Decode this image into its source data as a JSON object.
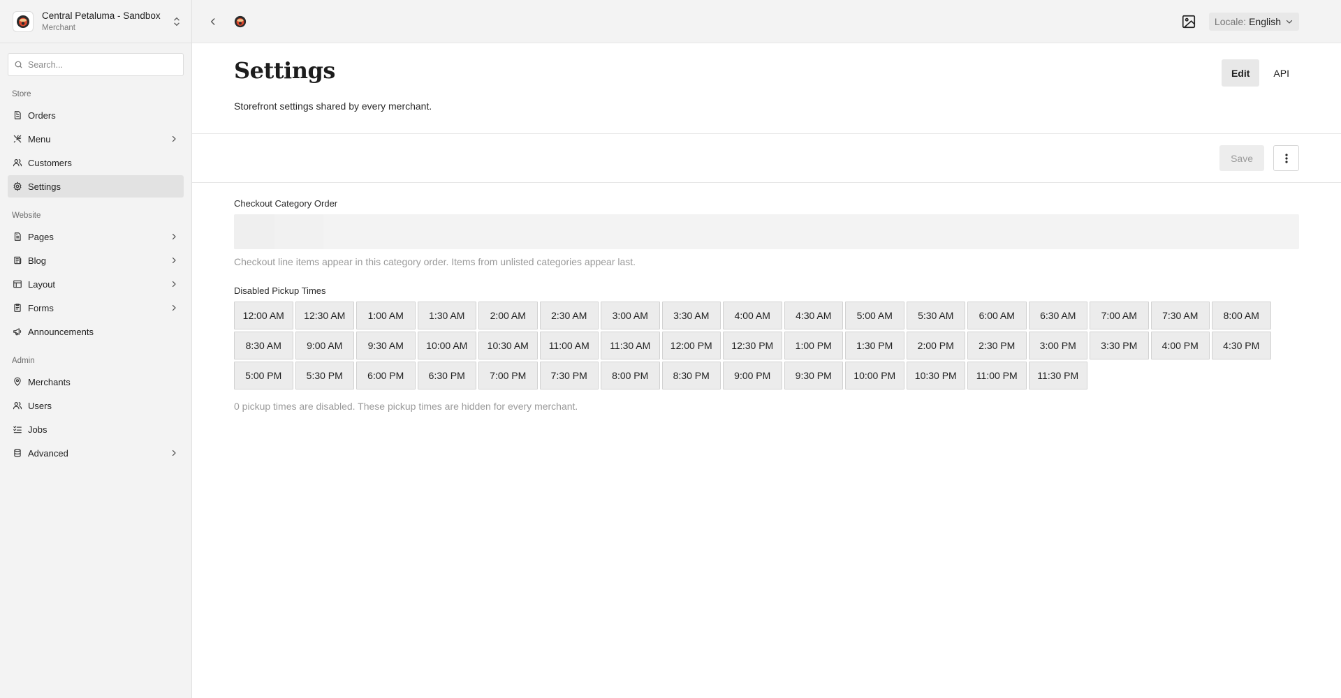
{
  "workspace": {
    "name": "Central Petaluma - Sandbox",
    "role": "Merchant"
  },
  "search": {
    "placeholder": "Search..."
  },
  "sidebar": {
    "sections": [
      {
        "label": "Store"
      },
      {
        "label": "Website"
      },
      {
        "label": "Admin"
      }
    ],
    "store": [
      {
        "label": "Orders",
        "icon": "document-icon"
      },
      {
        "label": "Menu",
        "icon": "utensils-icon"
      },
      {
        "label": "Customers",
        "icon": "users-icon"
      },
      {
        "label": "Settings",
        "icon": "gear-icon"
      }
    ],
    "website": [
      {
        "label": "Pages",
        "icon": "document-icon"
      },
      {
        "label": "Blog",
        "icon": "newspaper-icon"
      },
      {
        "label": "Layout",
        "icon": "layout-icon"
      },
      {
        "label": "Forms",
        "icon": "clipboard-icon"
      },
      {
        "label": "Announcements",
        "icon": "megaphone-icon"
      }
    ],
    "admin": [
      {
        "label": "Merchants",
        "icon": "location-pin-icon"
      },
      {
        "label": "Users",
        "icon": "users-icon"
      },
      {
        "label": "Jobs",
        "icon": "checklist-icon"
      },
      {
        "label": "Advanced",
        "icon": "database-icon"
      }
    ],
    "active": "Settings"
  },
  "topbar": {
    "locale_key": "Locale:",
    "locale_value": "English"
  },
  "header": {
    "title": "Settings",
    "subtitle": "Storefront settings shared by every merchant.",
    "tabs": [
      "Edit",
      "API"
    ],
    "active_tab": "Edit"
  },
  "toolbar": {
    "save_label": "Save"
  },
  "checkout": {
    "label": "Checkout Category Order",
    "help": "Checkout line items appear in this category order. Items from unlisted categories appear last."
  },
  "pickup": {
    "label": "Disabled Pickup Times",
    "times": [
      "12:00 AM",
      "12:30 AM",
      "1:00 AM",
      "1:30 AM",
      "2:00 AM",
      "2:30 AM",
      "3:00 AM",
      "3:30 AM",
      "4:00 AM",
      "4:30 AM",
      "5:00 AM",
      "5:30 AM",
      "6:00 AM",
      "6:30 AM",
      "7:00 AM",
      "7:30 AM",
      "8:00 AM",
      "8:30 AM",
      "9:00 AM",
      "9:30 AM",
      "10:00 AM",
      "10:30 AM",
      "11:00 AM",
      "11:30 AM",
      "12:00 PM",
      "12:30 PM",
      "1:00 PM",
      "1:30 PM",
      "2:00 PM",
      "2:30 PM",
      "3:00 PM",
      "3:30 PM",
      "4:00 PM",
      "4:30 PM",
      "5:00 PM",
      "5:30 PM",
      "6:00 PM",
      "6:30 PM",
      "7:00 PM",
      "7:30 PM",
      "8:00 PM",
      "8:30 PM",
      "9:00 PM",
      "9:30 PM",
      "10:00 PM",
      "10:30 PM",
      "11:00 PM",
      "11:30 PM"
    ],
    "help": "0 pickup times are disabled. These pickup times are hidden for every merchant."
  }
}
